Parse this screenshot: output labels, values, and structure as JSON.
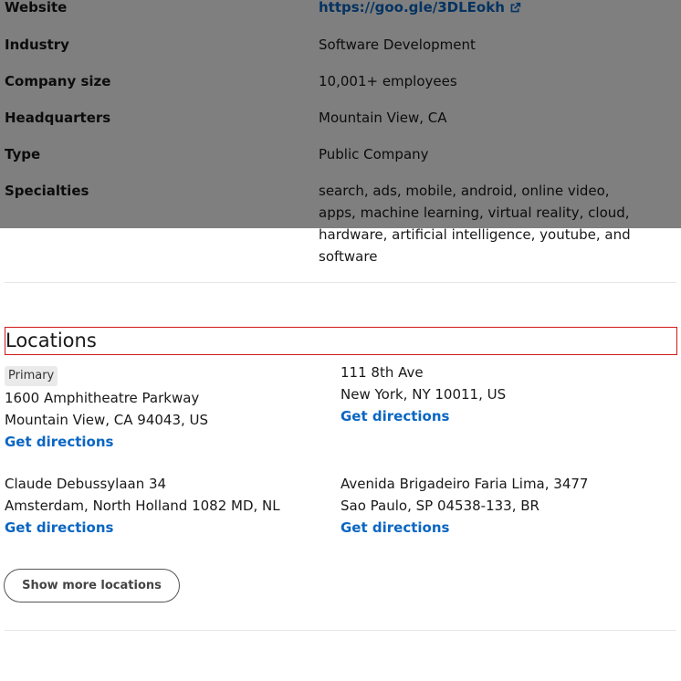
{
  "about": {
    "website": {
      "label": "Website",
      "value": "https://goo.gle/3DLEokh",
      "icon": "external-link-icon"
    },
    "industry": {
      "label": "Industry",
      "value": "Software Development"
    },
    "company_size": {
      "label": "Company size",
      "value": "10,001+ employees"
    },
    "headquarters": {
      "label": "Headquarters",
      "value": "Mountain View, CA"
    },
    "type": {
      "label": "Type",
      "value": "Public Company"
    },
    "specialties": {
      "label": "Specialties",
      "value": "search, ads, mobile, android, online video, apps, machine learning, virtual reality, cloud, hardware, artificial intelligence, youtube, and software"
    }
  },
  "locations": {
    "title": "Locations",
    "items": [
      {
        "badge": "Primary",
        "line1": "1600 Amphitheatre Parkway",
        "line2": "Mountain View, CA 94043, US",
        "directions": "Get directions"
      },
      {
        "line1": "111 8th Ave",
        "line2": "New York, NY 10011, US",
        "directions": "Get directions"
      },
      {
        "line1": "Claude Debussylaan 34",
        "line2": "Amsterdam, North Holland 1082 MD, NL",
        "directions": "Get directions"
      },
      {
        "line1": "Avenida Brigadeiro Faria Lima, 3477",
        "line2": "Sao Paulo, SP 04538-133, BR",
        "directions": "Get directions"
      }
    ],
    "show_more": "Show more locations"
  },
  "colors": {
    "link": "#0a66c2",
    "overlay": "rgba(0,0,0,0.5)",
    "highlight_border": "#d11a1a"
  }
}
